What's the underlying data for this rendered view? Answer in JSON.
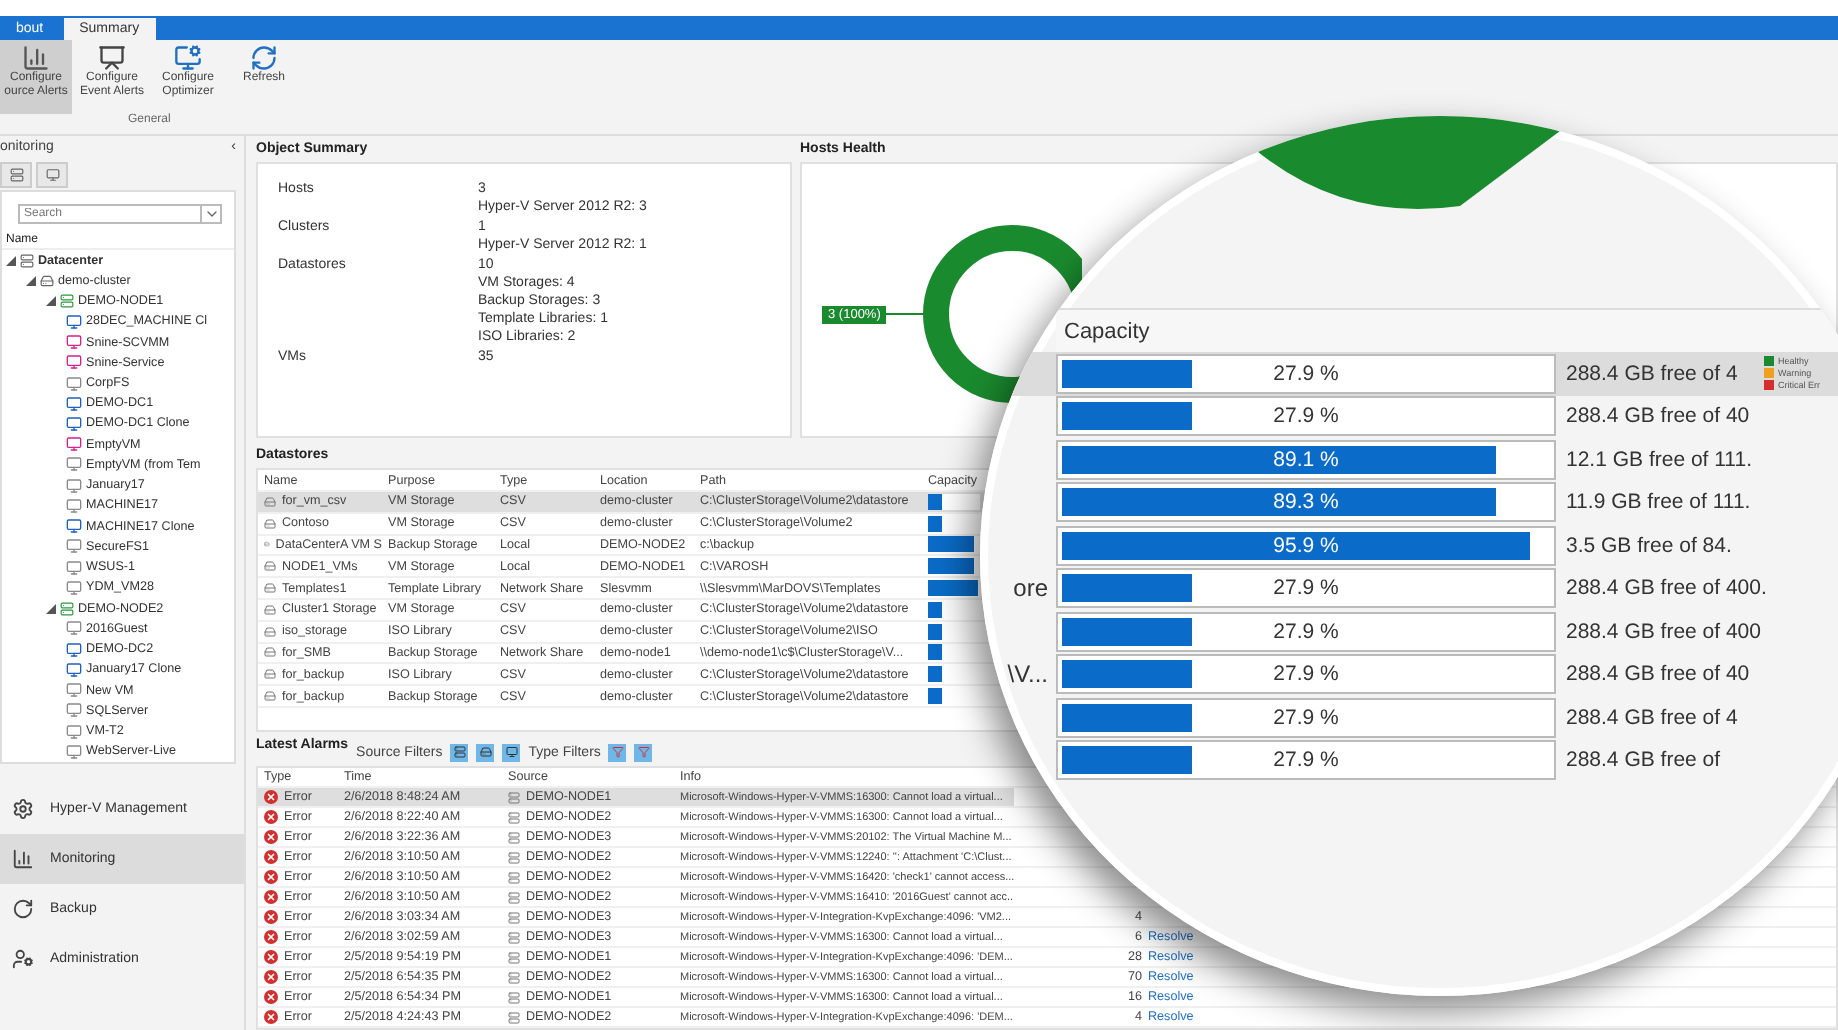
{
  "tabs": [
    {
      "label": "bout",
      "selected": false
    },
    {
      "label": "Summary",
      "selected": true
    }
  ],
  "ribbon": {
    "buttons": [
      {
        "lines": [
          "Configure",
          "ource Alerts"
        ],
        "selected": true
      },
      {
        "lines": [
          "Configure",
          "Event Alerts"
        ],
        "selected": false
      },
      {
        "lines": [
          "Configure",
          "Optimizer"
        ],
        "selected": false
      },
      {
        "lines": [
          "Refresh"
        ],
        "selected": false
      }
    ],
    "group": "General"
  },
  "sidebar": {
    "title": "onitoring",
    "collapse": "‹",
    "search": {
      "placeholder": "Search"
    },
    "tree_header": "Name",
    "tree": [
      {
        "label": "Datacenter",
        "kind": "datacenter",
        "expanded": true,
        "children": [
          {
            "label": "demo-cluster",
            "kind": "cluster",
            "expanded": true,
            "children": [
              {
                "label": "DEMO-NODE1",
                "kind": "host",
                "expanded": true,
                "children": [
                  {
                    "label": "28DEC_MACHINE Cl",
                    "kind": "vm",
                    "color": "#1f5fbf"
                  },
                  {
                    "label": "Snine-SCVMM",
                    "kind": "vm",
                    "color": "#d6218a"
                  },
                  {
                    "label": "Snine-Service",
                    "kind": "vm",
                    "color": "#d6218a"
                  },
                  {
                    "label": "CorpFS",
                    "kind": "vm",
                    "color": "#8a8a8a"
                  },
                  {
                    "label": "DEMO-DC1",
                    "kind": "vm",
                    "color": "#1f5fbf"
                  },
                  {
                    "label": "DEMO-DC1 Clone",
                    "kind": "vm",
                    "color": "#1f5fbf"
                  },
                  {
                    "label": "EmptyVM",
                    "kind": "vm",
                    "color": "#d6218a"
                  },
                  {
                    "label": "EmptyVM (from Tem",
                    "kind": "vm",
                    "color": "#8a8a8a"
                  },
                  {
                    "label": "January17",
                    "kind": "vm",
                    "color": "#8a8a8a"
                  },
                  {
                    "label": "MACHINE17",
                    "kind": "vm",
                    "color": "#8a8a8a"
                  },
                  {
                    "label": "MACHINE17 Clone",
                    "kind": "vm",
                    "color": "#1f5fbf"
                  },
                  {
                    "label": "SecureFS1",
                    "kind": "vm",
                    "color": "#8a8a8a"
                  },
                  {
                    "label": "WSUS-1",
                    "kind": "vm",
                    "color": "#8a8a8a"
                  },
                  {
                    "label": "YDM_VM28",
                    "kind": "vm",
                    "color": "#8a8a8a"
                  }
                ]
              },
              {
                "label": "DEMO-NODE2",
                "kind": "host",
                "expanded": true,
                "children": [
                  {
                    "label": "2016Guest",
                    "kind": "vm",
                    "color": "#8a8a8a"
                  },
                  {
                    "label": "DEMO-DC2",
                    "kind": "vm",
                    "color": "#1f5fbf"
                  },
                  {
                    "label": "January17 Clone",
                    "kind": "vm",
                    "color": "#1f5fbf"
                  },
                  {
                    "label": "New VM",
                    "kind": "vm",
                    "color": "#8a8a8a"
                  },
                  {
                    "label": "SQLServer",
                    "kind": "vm",
                    "color": "#8a8a8a"
                  },
                  {
                    "label": "VM-T2",
                    "kind": "vm",
                    "color": "#8a8a8a"
                  },
                  {
                    "label": "WebServer-Live",
                    "kind": "vm",
                    "color": "#8a8a8a"
                  }
                ]
              }
            ]
          }
        ]
      }
    ],
    "nav": [
      {
        "label": "Hyper-V Management",
        "selected": false
      },
      {
        "label": "Monitoring",
        "selected": true
      },
      {
        "label": "Backup",
        "selected": false
      },
      {
        "label": "Administration",
        "selected": false
      }
    ]
  },
  "object_summary": {
    "title": "Object Summary",
    "rows": [
      {
        "label": "Hosts",
        "values": [
          "3",
          "Hyper-V Server 2012 R2: 3"
        ]
      },
      {
        "label": "Clusters",
        "values": [
          "1",
          "Hyper-V Server 2012 R2: 1"
        ]
      },
      {
        "label": "Datastores",
        "values": [
          "10",
          "VM Storages: 4",
          "Backup Storages: 3",
          "Template Libraries: 1",
          "ISO Libraries: 2"
        ]
      },
      {
        "label": "VMs",
        "values": [
          "35"
        ]
      }
    ]
  },
  "hosts_health": {
    "title": "Hosts Health",
    "donut_label": "3 (100%)",
    "legend": [
      {
        "label": "Healthy",
        "color": "#1a8a2e"
      },
      {
        "label": "Warning",
        "color": "#f0a020"
      },
      {
        "label": "Critical Err",
        "color": "#d32f2f"
      }
    ]
  },
  "datastores": {
    "title": "Datastores",
    "columns": [
      "Name",
      "Purpose",
      "Type",
      "Location",
      "Path",
      "Capacity"
    ],
    "rows": [
      {
        "name": "for_vm_csv",
        "purpose": "VM Storage",
        "type": "CSV",
        "location": "demo-cluster",
        "path": "C:\\ClusterStorage\\Volume2\\datastore",
        "level": 0.279,
        "reading": "27.9 %",
        "free": "288.4 GB free of 4",
        "selected": true
      },
      {
        "name": "Contoso",
        "purpose": "VM Storage",
        "type": "CSV",
        "location": "demo-cluster",
        "path": "C:\\ClusterStorage\\Volume2",
        "level": 0.279,
        "reading": "27.9 %",
        "free": "288.4 GB free of 40",
        "selected": false
      },
      {
        "name": "DataCenterA VM S",
        "purpose": "Backup Storage",
        "type": "Local",
        "location": "DEMO-NODE2",
        "path": "c:\\backup",
        "level": 0.891,
        "reading": "89.1 %",
        "free": "12.1 GB free of 111.",
        "selected": false
      },
      {
        "name": "NODE1_VMs",
        "purpose": "VM Storage",
        "type": "Local",
        "location": "DEMO-NODE1",
        "path": "C:\\VAROSH",
        "level": 0.893,
        "reading": "89.3 %",
        "free": "11.9 GB free of 111.",
        "selected": false
      },
      {
        "name": "Templates1",
        "purpose": "Template Library",
        "type": "Network Share",
        "location": "Slesvmm",
        "path": "\\\\Slesvmm\\MarDOVS\\Templates",
        "level": 0.959,
        "reading": "95.9 %",
        "free": "3.5 GB free of 84.",
        "selected": false
      },
      {
        "name": "Cluster1 Storage",
        "purpose": "VM Storage",
        "type": "CSV",
        "location": "demo-cluster",
        "path": "C:\\ClusterStorage\\Volume2\\datastore",
        "level": 0.279,
        "reading": "27.9 %",
        "free": "288.4 GB free of 400.",
        "magnified_fragment": "ore",
        "selected": false
      },
      {
        "name": "iso_storage",
        "purpose": "ISO Library",
        "type": "CSV",
        "location": "demo-cluster",
        "path": "C:\\ClusterStorage\\Volume2\\ISO",
        "level": 0.279,
        "reading": "27.9 %",
        "free": "288.4 GB free of 400",
        "selected": false
      },
      {
        "name": "for_SMB",
        "purpose": "Backup Storage",
        "type": "Network Share",
        "location": "demo-node1",
        "path": "\\\\demo-node1\\c$\\ClusterStorage\\V...",
        "level": 0.279,
        "reading": "27.9 %",
        "free": "288.4 GB free of 40",
        "magnified_fragment": "\\V...",
        "selected": false
      },
      {
        "name": "for_backup",
        "purpose": "ISO Library",
        "type": "CSV",
        "location": "demo-cluster",
        "path": "C:\\ClusterStorage\\Volume2\\datastore",
        "level": 0.279,
        "reading": "27.9 %",
        "free": "288.4 GB free of 4",
        "selected": false
      },
      {
        "name": "for_backup",
        "purpose": "Backup Storage",
        "type": "CSV",
        "location": "demo-cluster",
        "path": "C:\\ClusterStorage\\Volume2\\datastore",
        "level": 0.279,
        "reading": "27.9 %",
        "free": "288.4 GB free of",
        "selected": false
      }
    ]
  },
  "magnifier": {
    "header": "Capacity"
  },
  "alarms": {
    "title": "Latest Alarms",
    "source_filters": "Source Filters",
    "type_filters": "Type Filters",
    "columns": [
      "Type",
      "Time",
      "Source",
      "Info"
    ],
    "rows": [
      {
        "type": "Error",
        "time": "2/6/2018 8:48:24 AM",
        "source": "DEMO-NODE1",
        "info": "Microsoft-Windows-Hyper-V-VMMS:16300: Cannot load a virtual...",
        "selected": true
      },
      {
        "type": "Error",
        "time": "2/6/2018 8:22:40 AM",
        "source": "DEMO-NODE2",
        "info": "Microsoft-Windows-Hyper-V-VMMS:16300: Cannot load a virtual...",
        "selected": false
      },
      {
        "type": "Error",
        "time": "2/6/2018 3:22:36 AM",
        "source": "DEMO-NODE3",
        "info": "Microsoft-Windows-Hyper-V-VMMS:20102: The Virtual Machine M...",
        "selected": false
      },
      {
        "type": "Error",
        "time": "2/6/2018 3:10:50 AM",
        "source": "DEMO-NODE2",
        "info": "Microsoft-Windows-Hyper-V-VMMS:12240: '': Attachment 'C:\\Clust...",
        "selected": false
      },
      {
        "type": "Error",
        "time": "2/6/2018 3:10:50 AM",
        "source": "DEMO-NODE2",
        "info": "Microsoft-Windows-Hyper-V-VMMS:16420: 'check1' cannot access...",
        "selected": false
      },
      {
        "type": "Error",
        "time": "2/6/2018 3:10:50 AM",
        "source": "DEMO-NODE2",
        "info": "Microsoft-Windows-Hyper-V-VMMS:16410: '2016Guest' cannot acc...",
        "selected": false
      },
      {
        "type": "Error",
        "time": "2/6/2018 3:03:34 AM",
        "source": "DEMO-NODE3",
        "info": "Microsoft-Windows-Hyper-V-Integration-KvpExchange:4096: 'VM2...",
        "count": "4",
        "selected": false
      },
      {
        "type": "Error",
        "time": "2/6/2018 3:02:59 AM",
        "source": "DEMO-NODE3",
        "info": "Microsoft-Windows-Hyper-V-VMMS:16300: Cannot load a virtual...",
        "count": "6",
        "action": "Resolve",
        "selected": false
      },
      {
        "type": "Error",
        "time": "2/5/2018 9:54:19 PM",
        "source": "DEMO-NODE1",
        "info": "Microsoft-Windows-Hyper-V-Integration-KvpExchange:4096: 'DEM...",
        "count": "28",
        "action": "Resolve",
        "selected": false
      },
      {
        "type": "Error",
        "time": "2/5/2018 6:54:35 PM",
        "source": "DEMO-NODE2",
        "info": "Microsoft-Windows-Hyper-V-VMMS:16300: Cannot load a virtual...",
        "count": "70",
        "action": "Resolve",
        "selected": false
      },
      {
        "type": "Error",
        "time": "2/5/2018 6:54:34 PM",
        "source": "DEMO-NODE1",
        "info": "Microsoft-Windows-Hyper-V-VMMS:16300: Cannot load a virtual...",
        "count": "16",
        "action": "Resolve",
        "selected": false
      },
      {
        "type": "Error",
        "time": "2/5/2018 4:24:43 PM",
        "source": "DEMO-NODE2",
        "info": "Microsoft-Windows-Hyper-V-Integration-KvpExchange:4096: 'DEM...",
        "count": "4",
        "action": "Resolve",
        "selected": false
      }
    ]
  }
}
